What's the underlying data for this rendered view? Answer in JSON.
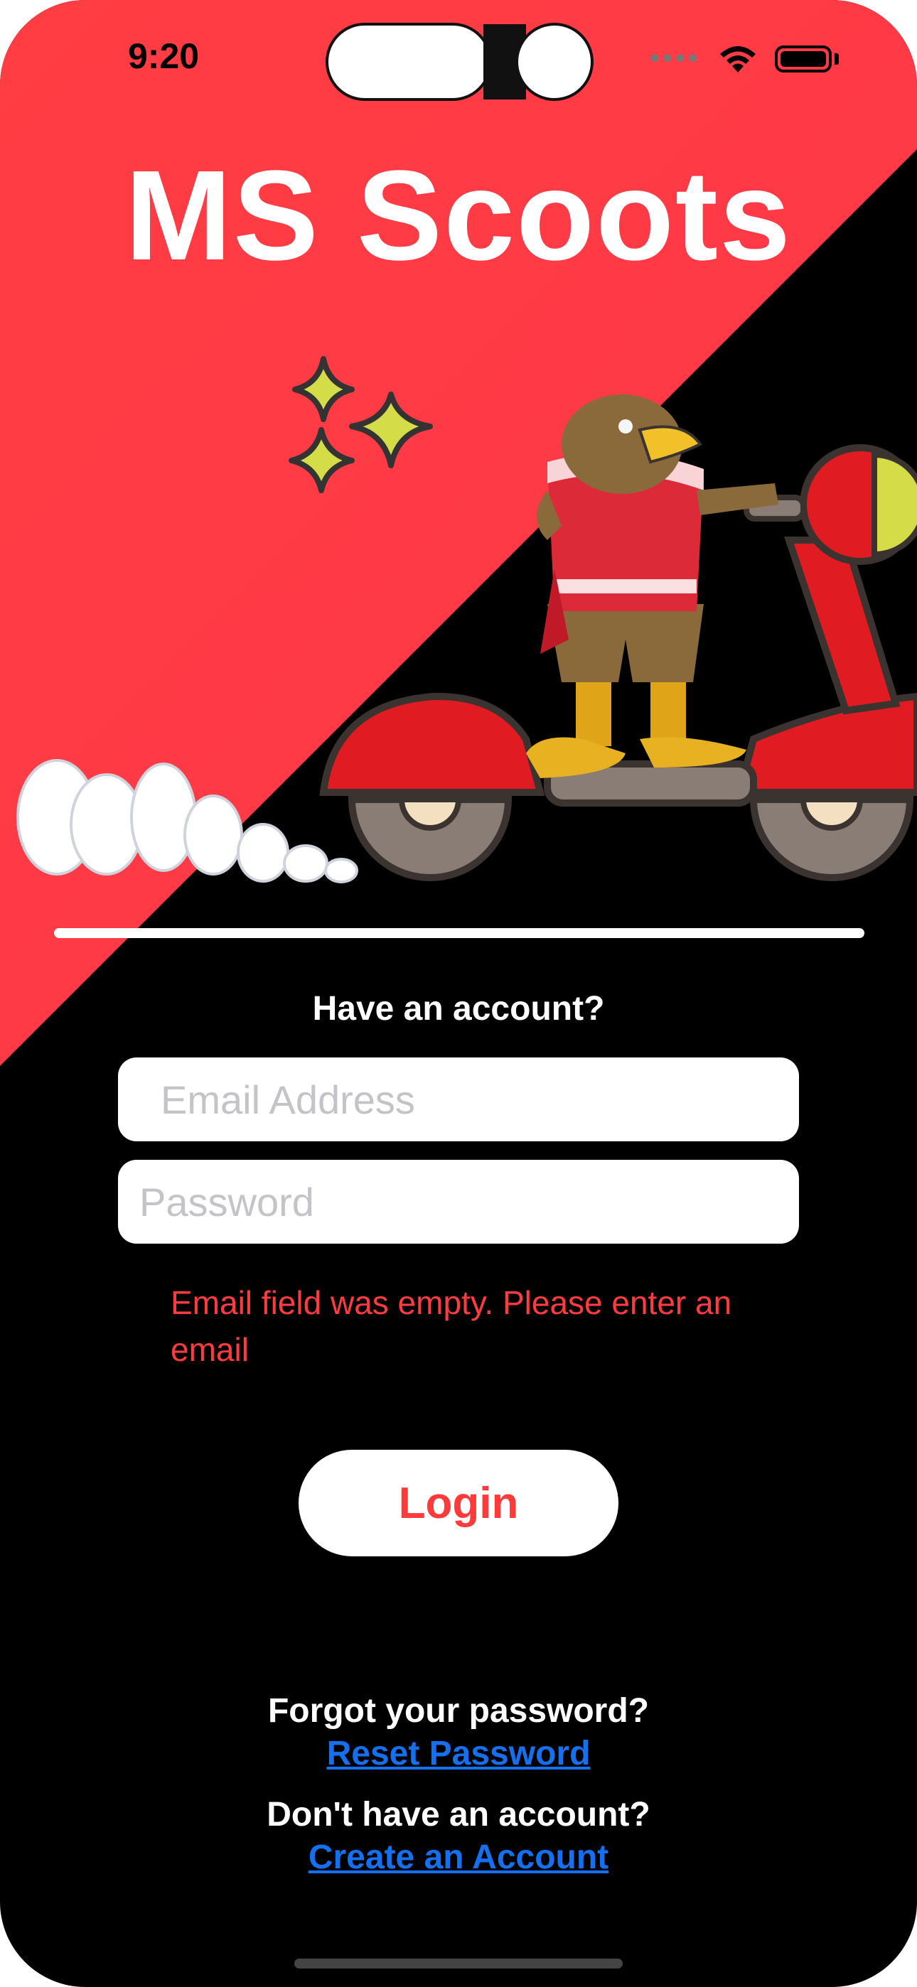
{
  "status_bar": {
    "time": "9:20"
  },
  "app": {
    "title": "MS Scoots"
  },
  "login": {
    "prompt": "Have an account?",
    "email_placeholder": "Email Address",
    "password_placeholder": "Password",
    "error_message": "Email field was empty. Please enter an email",
    "login_label": "Login"
  },
  "footer": {
    "forgot_prompt": "Forgot your password?",
    "reset_link": "Reset Password",
    "no_account_prompt": "Don't have an account?",
    "create_link": "Create an Account"
  },
  "colors": {
    "brand_red": "#ff3d42",
    "link_blue": "#1570ef",
    "error_red": "#ff3b3f"
  },
  "icons": [
    "wifi-icon",
    "battery-icon",
    "signal-icon",
    "sparkles-icon",
    "scooter-illustration",
    "mascot-illustration",
    "smoke-cloud-illustration"
  ]
}
